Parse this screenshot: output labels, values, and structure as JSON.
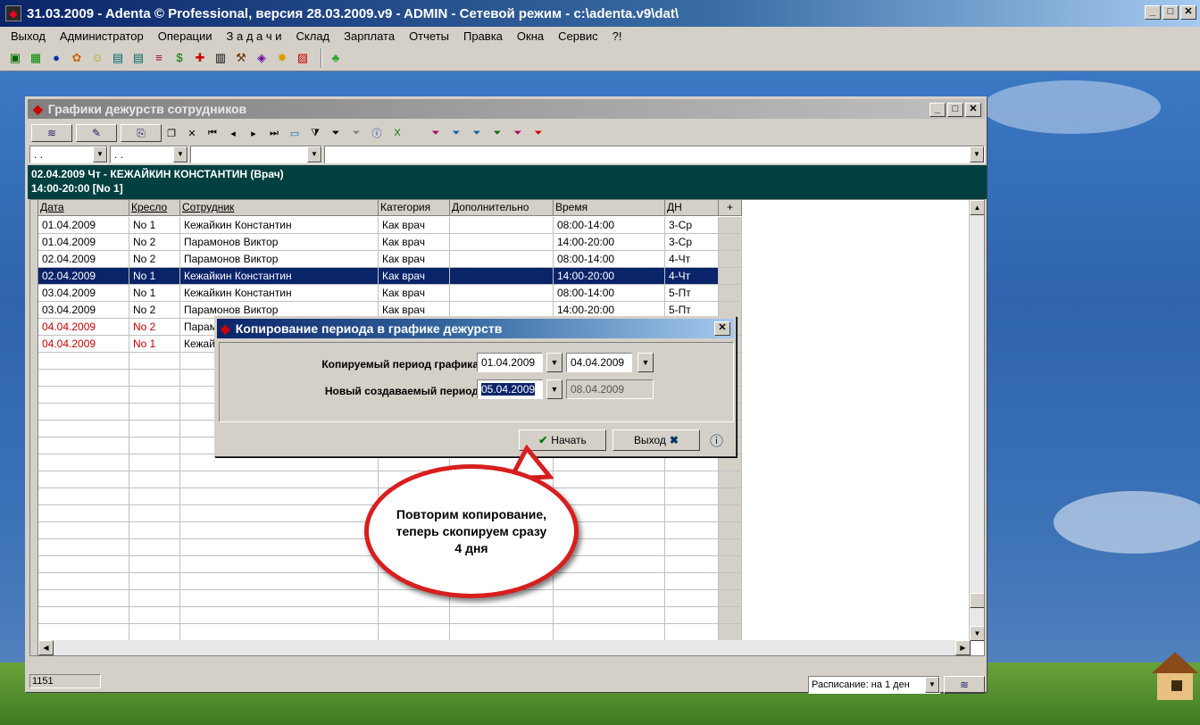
{
  "app": {
    "title": "31.03.2009 - Adenta © Professional, версия 28.03.2009.v9 - ADMIN - Сетевой режим - c:\\adenta.v9\\dat\\",
    "menu": [
      "Выход",
      "Администратор",
      "Операции",
      "З а д а ч и",
      "Склад",
      "Зарплата",
      "Отчеты",
      "Правка",
      "Окна",
      "Сервис",
      "?!"
    ]
  },
  "child": {
    "title": "Графики дежурств сотрудников",
    "filter1": ". .",
    "filter2": ". .",
    "info_line1": "02.04.2009 Чт - КЕЖАЙКИН КОНСТАНТИН (Врач)",
    "info_line2": "14:00-20:00 [No 1]",
    "columns": [
      "Дата",
      "Кресло",
      "Сотрудник",
      "Категория",
      "Дополнительно",
      "Время",
      "ДН",
      "+"
    ],
    "rows": [
      {
        "date": "01.04.2009",
        "chair": "No 1",
        "employee": "Кежайкин Константин",
        "category": "Как врач",
        "extra": "",
        "time": "08:00-14:00",
        "day": "3-Ср"
      },
      {
        "date": "01.04.2009",
        "chair": "No 2",
        "employee": "Парамонов Виктор",
        "category": "Как врач",
        "extra": "",
        "time": "14:00-20:00",
        "day": "3-Ср"
      },
      {
        "date": "02.04.2009",
        "chair": "No 2",
        "employee": "Парамонов Виктор",
        "category": "Как врач",
        "extra": "",
        "time": "08:00-14:00",
        "day": "4-Чт"
      },
      {
        "date": "02.04.2009",
        "chair": "No 1",
        "employee": "Кежайкин Константин",
        "category": "Как врач",
        "extra": "",
        "time": "14:00-20:00",
        "day": "4-Чт"
      },
      {
        "date": "03.04.2009",
        "chair": "No 1",
        "employee": "Кежайкин Константин",
        "category": "Как врач",
        "extra": "",
        "time": "08:00-14:00",
        "day": "5-Пт"
      },
      {
        "date": "03.04.2009",
        "chair": "No 2",
        "employee": "Парамонов Виктор",
        "category": "Как врач",
        "extra": "",
        "time": "14:00-20:00",
        "day": "5-Пт"
      },
      {
        "date": "04.04.2009",
        "chair": "No 2",
        "employee": "Парам",
        "category": "",
        "extra": "",
        "time": "",
        "day": ""
      },
      {
        "date": "04.04.2009",
        "chair": "No 1",
        "employee": "Кежай",
        "category": "",
        "extra": "",
        "time": "",
        "day": ""
      }
    ],
    "status_count": "1151",
    "schedule_select": "Расписание: на 1 ден"
  },
  "dialog": {
    "title": "Копирование периода в графике дежурств",
    "label_copy": "Копируемый период графика",
    "label_new": "Новый создаваемый период",
    "copy_from": "01.04.2009",
    "copy_to": "04.04.2009",
    "new_from": "05.04.2009",
    "new_to": "08.04.2009",
    "start_label": "Начать",
    "exit_label": "Выход"
  },
  "callout": "Повторим копирование, теперь скопируем сразу 4 дня"
}
